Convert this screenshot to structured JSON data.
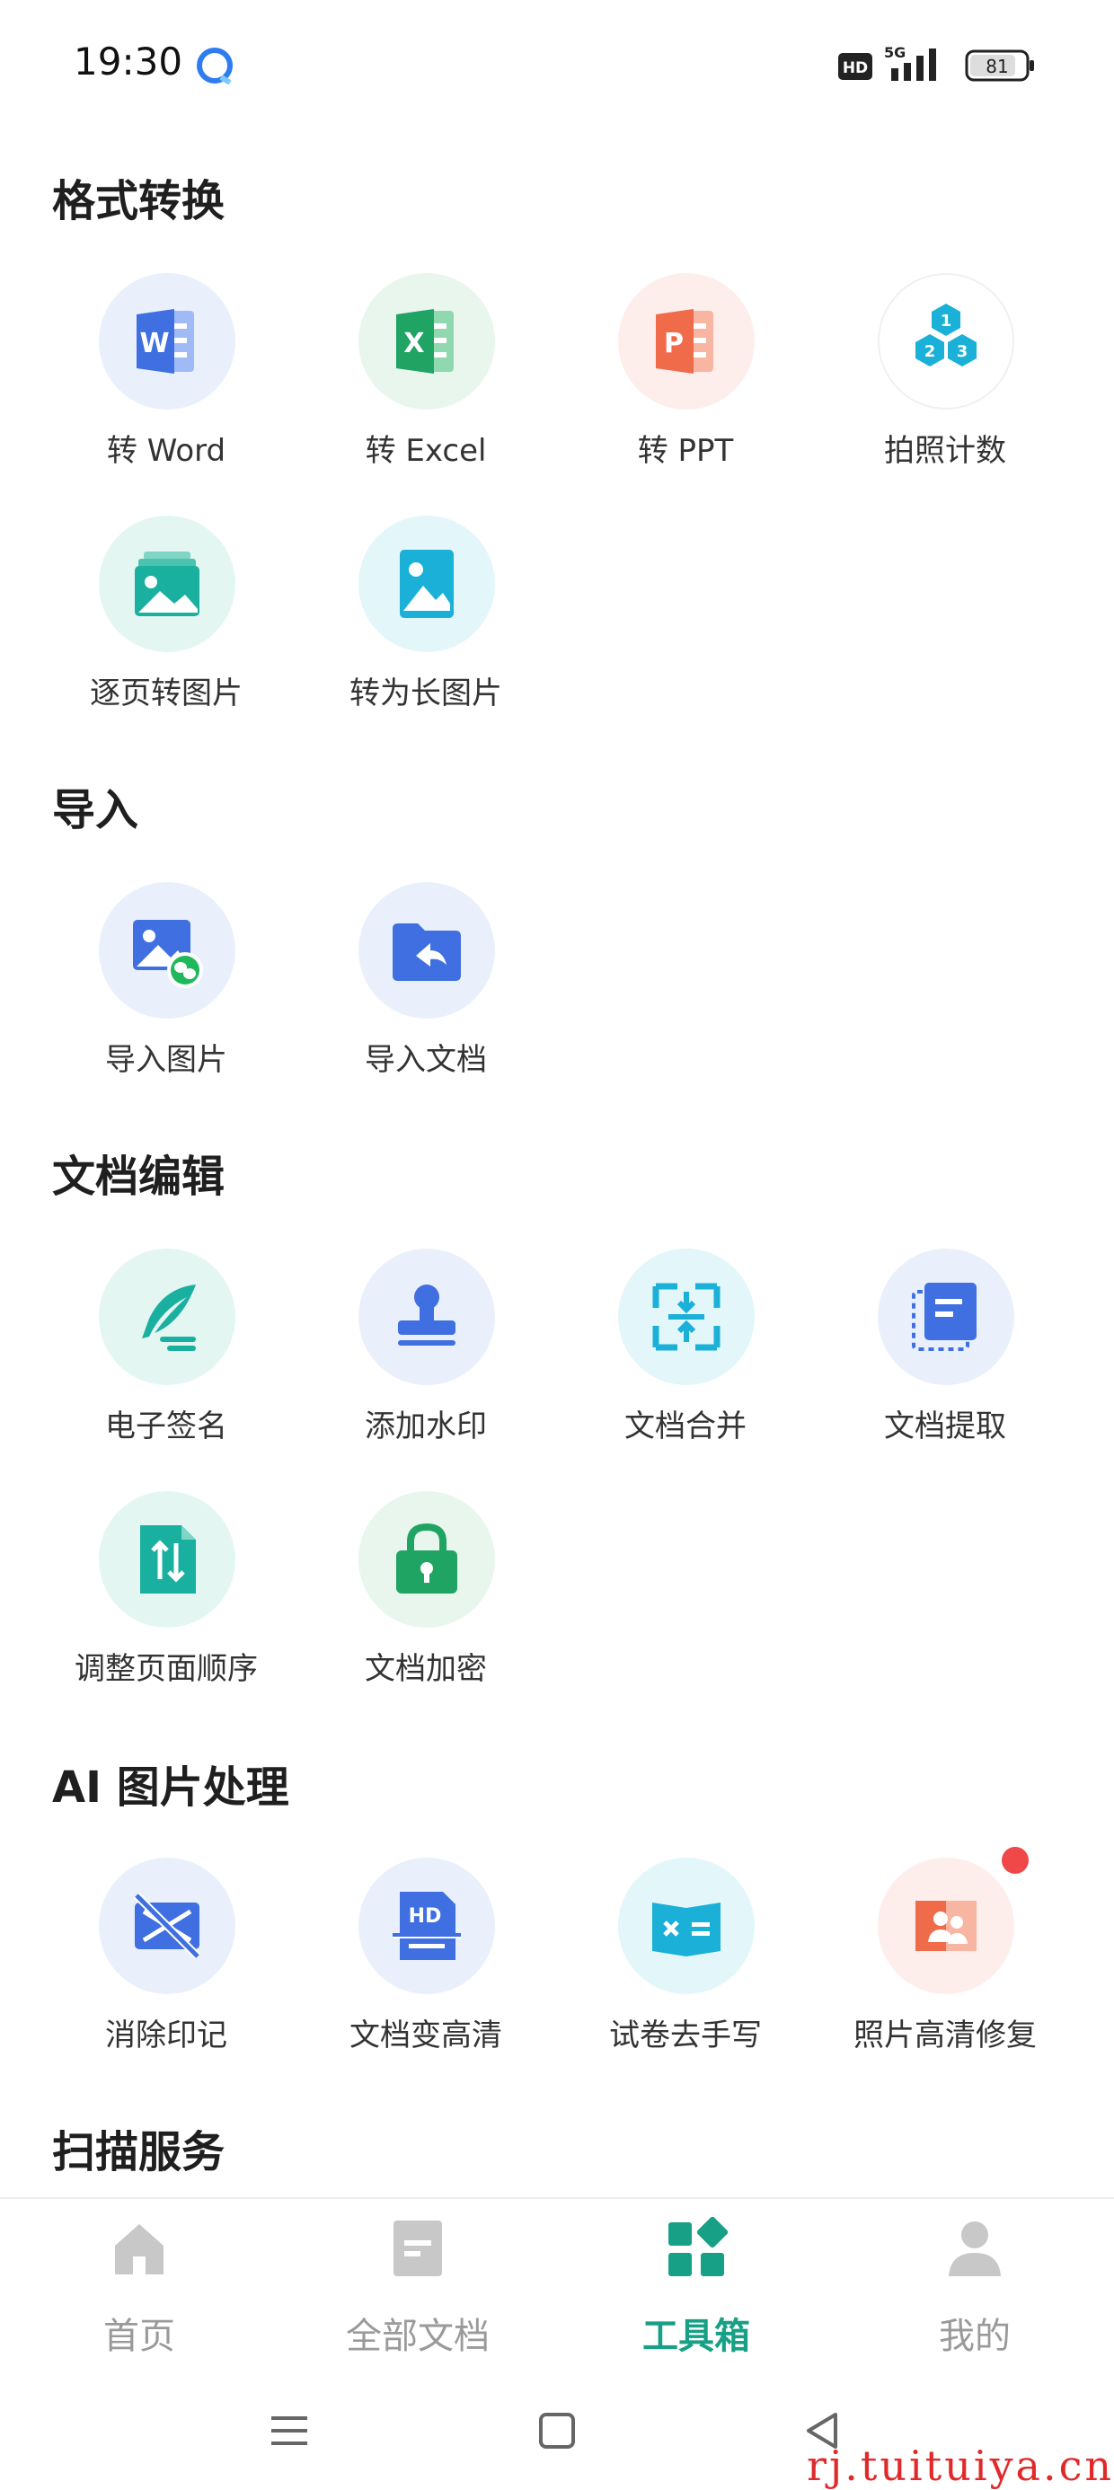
{
  "status_bar": {
    "time": "19:30",
    "battery": "81",
    "network": "5G"
  },
  "sections": {
    "format": {
      "title": "格式转换"
    },
    "import": {
      "title": "导入"
    },
    "edit": {
      "title": "文档编辑"
    },
    "ai": {
      "title": "AI 图片处理"
    },
    "scan": {
      "title": "扫描服务"
    }
  },
  "tools": {
    "to_word": "转 Word",
    "to_excel": "转 Excel",
    "to_ppt": "转 PPT",
    "photo_count": "拍照计数",
    "page_to_image": "逐页转图片",
    "to_long_image": "转为长图片",
    "import_image": "导入图片",
    "import_document": "导入文档",
    "e_signature": "电子签名",
    "add_watermark": "添加水印",
    "merge_document": "文档合并",
    "extract_document": "文档提取",
    "reorder_pages": "调整页面顺序",
    "encrypt_document": "文档加密",
    "remove_marks": "消除印记",
    "enhance_document": "文档变高清",
    "remove_handwriting": "试卷去手写",
    "photo_restore": "照片高清修复"
  },
  "photo_count_digits": [
    "1",
    "2",
    "3"
  ],
  "enhance_hd_text": "HD",
  "bottom_nav": {
    "home": "首页",
    "all_docs": "全部文档",
    "toolbox": "工具箱",
    "mine": "我的"
  },
  "watermark": "rj.tuituiya.cn",
  "colors": {
    "accent": "#17a085",
    "word_blue": "#3f6fe0",
    "excel_green": "#1fa463",
    "ppt_orange": "#f06b4a",
    "teal": "#1ab0a0",
    "cyan": "#1ab0d8",
    "badge_red": "#f04848"
  }
}
